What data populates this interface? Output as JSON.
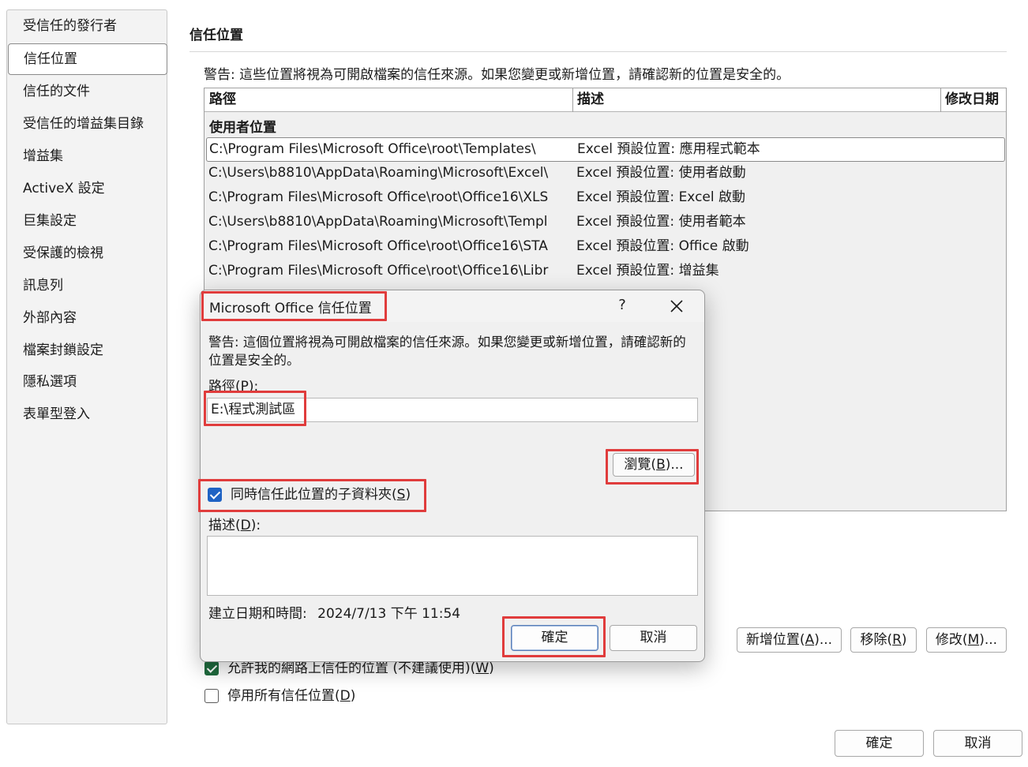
{
  "sidebar": {
    "items": [
      {
        "label": "受信任的發行者",
        "selected": false
      },
      {
        "label": "信任位置",
        "selected": true
      },
      {
        "label": "信任的文件",
        "selected": false
      },
      {
        "label": "受信任的增益集目錄",
        "selected": false
      },
      {
        "label": "增益集",
        "selected": false
      },
      {
        "label": "ActiveX 設定",
        "selected": false
      },
      {
        "label": "巨集設定",
        "selected": false
      },
      {
        "label": "受保護的檢視",
        "selected": false
      },
      {
        "label": "訊息列",
        "selected": false
      },
      {
        "label": "外部內容",
        "selected": false
      },
      {
        "label": "檔案封鎖設定",
        "selected": false
      },
      {
        "label": "隱私選項",
        "selected": false
      },
      {
        "label": "表單型登入",
        "selected": false
      }
    ]
  },
  "main": {
    "title": "信任位置",
    "warning": "警告: 這些位置將視為可開啟檔案的信任來源。如果您變更或新增位置，請確認新的位置是安全的。",
    "table": {
      "columns": [
        "路徑",
        "描述",
        "修改日期"
      ],
      "group_label": "使用者位置",
      "rows": [
        {
          "path": "C:\\Program Files\\Microsoft Office\\root\\Templates\\",
          "desc": "Excel 預設位置: 應用程式範本"
        },
        {
          "path": "C:\\Users\\b8810\\AppData\\Roaming\\Microsoft\\Excel\\",
          "desc": "Excel 預設位置: 使用者啟動"
        },
        {
          "path": "C:\\Program Files\\Microsoft Office\\root\\Office16\\XLS",
          "desc": "Excel 預設位置: Excel 啟動"
        },
        {
          "path": "C:\\Users\\b8810\\AppData\\Roaming\\Microsoft\\Templ",
          "desc": "Excel 預設位置: 使用者範本"
        },
        {
          "path": "C:\\Program Files\\Microsoft Office\\root\\Office16\\STA",
          "desc": "Excel 預設位置: Office 啟動"
        },
        {
          "path": "C:\\Program Files\\Microsoft Office\\root\\Office16\\Libr",
          "desc": "Excel 預設位置: 增益集"
        }
      ]
    },
    "buttons": {
      "add": {
        "text": "新增位置(",
        "key": "A",
        "tail": ")..."
      },
      "remove": {
        "text": "移除(",
        "key": "R",
        "tail": ")"
      },
      "modify": {
        "text": "修改(",
        "key": "M",
        "tail": ")..."
      }
    },
    "checkboxes": {
      "allow_network": {
        "text": "允許我的網路上信任的位置 (不建議使用)(",
        "key": "W",
        "tail": ")",
        "checked": true
      },
      "disable_all": {
        "text": "停用所有信任位置(",
        "key": "D",
        "tail": ")",
        "checked": false
      }
    },
    "ok_label": "確定",
    "cancel_label": "取消"
  },
  "dialog": {
    "title": "Microsoft Office 信任位置",
    "help_glyph": "?",
    "warning": "警告: 這個位置將視為可開啟檔案的信任來源。如果您變更或新增位置，請確認新的位置是安全的。",
    "path_label": {
      "text": "路徑(",
      "key": "P",
      "tail": "):"
    },
    "path_value": "E:\\程式測試區",
    "browse": {
      "text": "瀏覽(",
      "key": "B",
      "tail": ")..."
    },
    "subfolders": {
      "text": "同時信任此位置的子資料夾(",
      "key": "S",
      "tail": ")",
      "checked": true
    },
    "desc_label": {
      "text": "描述(",
      "key": "D",
      "tail": "):"
    },
    "desc_value": "",
    "created_label": "建立日期和時間:",
    "created_value": "2024/7/13 下午 11:54",
    "ok_label": "確定",
    "cancel_label": "取消"
  },
  "colors": {
    "highlight": "#e03c3c",
    "checkbox_green": "#1f6b3e",
    "checkbox_blue": "#1f63c4"
  }
}
